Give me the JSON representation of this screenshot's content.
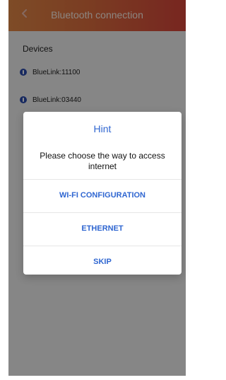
{
  "header": {
    "title": "Bluetooth connection"
  },
  "devices": {
    "label": "Devices",
    "items": [
      {
        "label": "BlueLink:11100"
      },
      {
        "label": "BlueLink:03440"
      }
    ]
  },
  "dialog": {
    "title": "Hint",
    "message": "Please choose the way to access internet",
    "buttons": [
      {
        "label": "WI-FI CONFIGURATION"
      },
      {
        "label": "ETHERNET"
      },
      {
        "label": "SKIP"
      }
    ]
  },
  "colors": {
    "accent": "#2f66d1",
    "header_start": "#e58a47",
    "header_end": "#d9463b",
    "device_dot": "#2b4bb0"
  },
  "icons": {
    "back": "chevron-left-icon",
    "device": "info-dot-icon"
  }
}
